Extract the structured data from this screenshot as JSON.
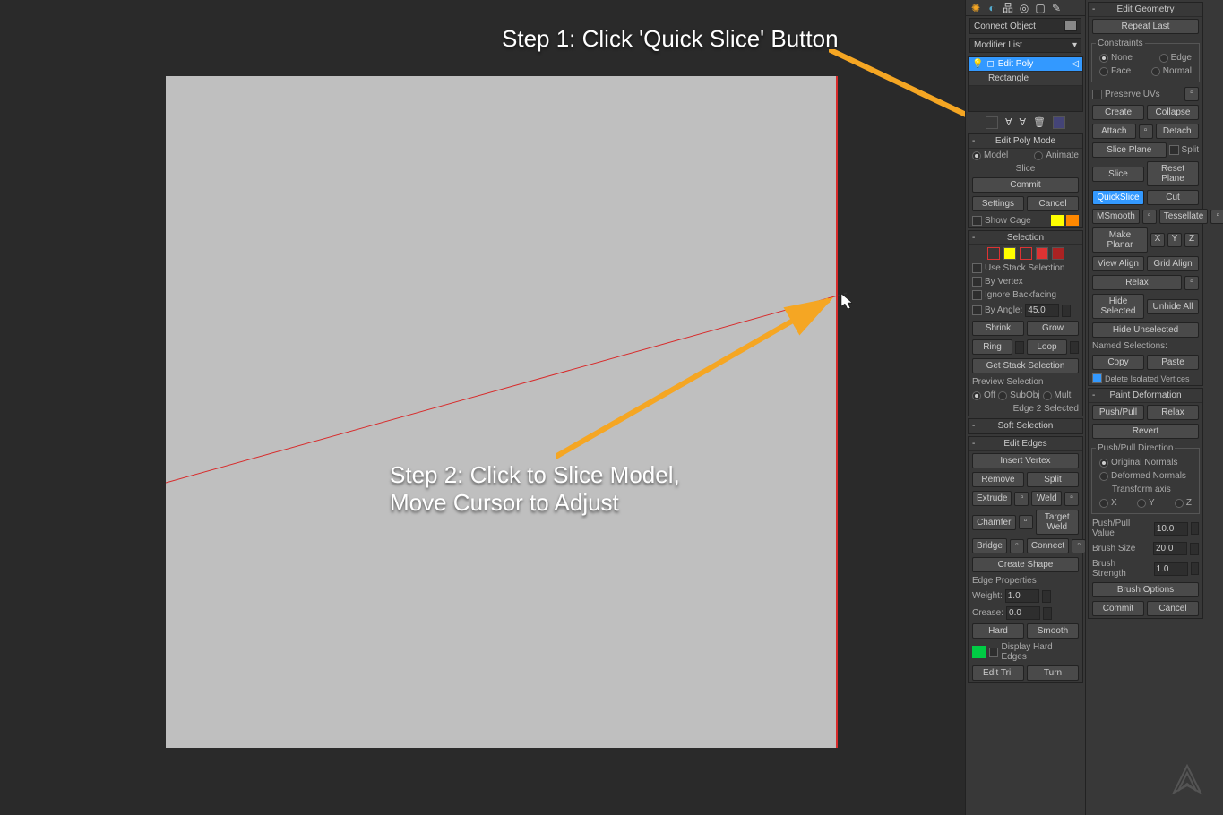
{
  "annotations": {
    "step1": "Step 1: Click 'Quick Slice' Button",
    "step2_line1": "Step 2: Click to Slice Model,",
    "step2_line2": "Move Cursor to Adjust"
  },
  "col1": {
    "connect_object": "Connect Object",
    "modifier_list": "Modifier List",
    "stack": {
      "edit_poly": "Edit Poly",
      "rectangle": "Rectangle"
    },
    "edit_poly_mode": {
      "title": "Edit Poly Mode",
      "model": "Model",
      "animate": "Animate",
      "slice": "Slice",
      "commit": "Commit",
      "settings": "Settings",
      "cancel": "Cancel",
      "show_cage": "Show Cage"
    },
    "selection": {
      "title": "Selection",
      "use_stack": "Use Stack Selection",
      "by_vertex": "By Vertex",
      "ignore_backfacing": "Ignore Backfacing",
      "by_angle": "By Angle:",
      "angle_val": "45.0",
      "shrink": "Shrink",
      "grow": "Grow",
      "ring": "Ring",
      "loop": "Loop",
      "get_stack": "Get Stack Selection",
      "preview": "Preview Selection",
      "off": "Off",
      "subobj": "SubObj",
      "multi": "Multi",
      "status": "Edge 2 Selected"
    },
    "soft_selection": "Soft Selection",
    "edit_edges": {
      "title": "Edit Edges",
      "insert_vertex": "Insert Vertex",
      "remove": "Remove",
      "split": "Split",
      "extrude": "Extrude",
      "weld": "Weld",
      "chamfer": "Chamfer",
      "target_weld": "Target Weld",
      "bridge": "Bridge",
      "connect": "Connect",
      "create_shape": "Create Shape",
      "edge_props": "Edge Properties",
      "weight": "Weight:",
      "weight_val": "1.0",
      "crease": "Crease:",
      "crease_val": "0.0",
      "hard": "Hard",
      "smooth": "Smooth",
      "display_hard": "Display Hard Edges",
      "edit_tri": "Edit Tri.",
      "turn": "Turn"
    }
  },
  "col2": {
    "edit_geometry": {
      "title": "Edit Geometry",
      "repeat_last": "Repeat Last",
      "constraints": "Constraints",
      "none": "None",
      "edge": "Edge",
      "face": "Face",
      "normal": "Normal",
      "preserve_uvs": "Preserve UVs",
      "create": "Create",
      "collapse": "Collapse",
      "attach": "Attach",
      "detach": "Detach",
      "slice_plane": "Slice Plane",
      "split": "Split",
      "slice": "Slice",
      "reset_plane": "Reset Plane",
      "quickslice": "QuickSlice",
      "cut": "Cut",
      "msmooth": "MSmooth",
      "tessellate": "Tessellate",
      "make_planar": "Make Planar",
      "x": "X",
      "y": "Y",
      "z": "Z",
      "view_align": "View Align",
      "grid_align": "Grid Align",
      "relax": "Relax",
      "hide_selected": "Hide Selected",
      "unhide_all": "Unhide All",
      "hide_unselected": "Hide Unselected",
      "named_selections": "Named Selections:",
      "copy": "Copy",
      "paste": "Paste",
      "delete_isolated": "Delete Isolated Vertices"
    },
    "paint_deform": {
      "title": "Paint Deformation",
      "push_pull": "Push/Pull",
      "relax": "Relax",
      "revert": "Revert",
      "direction": "Push/Pull Direction",
      "original": "Original Normals",
      "deformed": "Deformed Normals",
      "transform_axis": "Transform axis",
      "x": "X",
      "y": "Y",
      "z": "Z",
      "push_pull_value": "Push/Pull Value",
      "ppv": "10.0",
      "brush_size": "Brush Size",
      "bs": "20.0",
      "brush_strength": "Brush Strength",
      "bst": "1.0",
      "brush_options": "Brush Options",
      "commit": "Commit",
      "cancel": "Cancel"
    }
  }
}
